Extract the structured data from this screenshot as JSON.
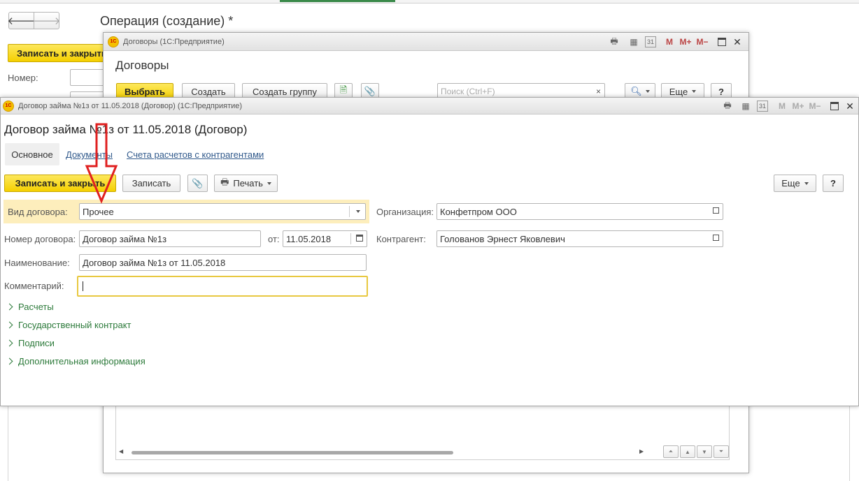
{
  "back_window": {
    "title": "Операция (создание) *",
    "save_close_label": "Записать и закрыть",
    "number_label": "Номер:"
  },
  "contracts_window": {
    "titlebar_text": "Договоры  (1С:Предприятие)",
    "heading": "Договоры",
    "select_label": "Выбрать",
    "create_label": "Создать",
    "create_group_label": "Создать группу",
    "search_placeholder": "Поиск (Ctrl+F)",
    "more_label": "Еще",
    "help_label": "?"
  },
  "contract_form": {
    "titlebar_text": "Договор займа №1з от 11.05.2018 (Договор)  (1С:Предприятие)",
    "heading": "Договор займа №1з от 11.05.2018 (Договор)",
    "tabs": [
      {
        "label": "Основное"
      },
      {
        "label": "Документы"
      },
      {
        "label": "Счета расчетов с контрагентами"
      }
    ],
    "toolbar": {
      "save_close_label": "Записать и закрыть",
      "save_label": "Записать",
      "print_label": "Печать",
      "more_label": "Еще",
      "help_label": "?"
    },
    "fields": {
      "contract_type_label": "Вид договора:",
      "contract_type_value": "Прочее",
      "contract_number_label": "Номер договора:",
      "contract_number_value": "Договор займа №1з",
      "date_label": "от:",
      "date_value": "11.05.2018",
      "name_label": "Наименование:",
      "name_value": "Договор займа №1з от 11.05.2018",
      "comment_label": "Комментарий:",
      "comment_value": "",
      "organization_label": "Организация:",
      "organization_value": "Конфетпром ООО",
      "counterparty_label": "Контрагент:",
      "counterparty_value": "Голованов Эрнест Яковлевич"
    },
    "groups": [
      {
        "label": "Расчеты"
      },
      {
        "label": "Государственный контракт"
      },
      {
        "label": "Подписи"
      },
      {
        "label": "Дополнительная информация"
      }
    ]
  },
  "colors": {
    "accent_yellow": "#f5d000",
    "highlight_field": "#fdeebc",
    "link_blue": "#315a8c",
    "group_green": "#2c7a3a",
    "annotation_arrow": "#e02020"
  }
}
